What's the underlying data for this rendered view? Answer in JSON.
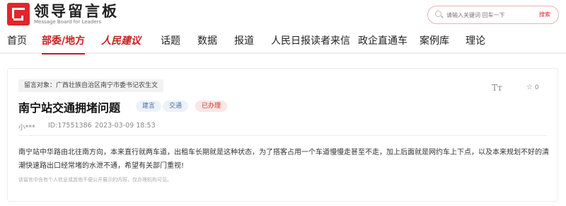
{
  "header": {
    "logo_cn": "领导留言板",
    "logo_en": "Message Board for Leaders",
    "search_placeholder": "请输入关键词 回车一下",
    "search_button": "搜索"
  },
  "nav": [
    "首页",
    "部委/地方",
    "人民建议",
    "话题",
    "数据",
    "报道",
    "人民日报读者来信",
    "政企直通车",
    "案例库",
    "理论"
  ],
  "message": {
    "target": "留言对象：广西壮族自治区南宁市委书记农生文",
    "title": "南宁站交通拥堵问题",
    "tags": [
      "建言",
      "交通",
      "已办理"
    ],
    "author": "小***",
    "id": "ID:17551386",
    "time": "2023-03-09 18:53",
    "font_icon": "Tт",
    "favorites": "0",
    "content": "南宁站中华路由北往南方向，本来直行就两车道，出租车长期就是这种状态，为了搭客占用一个车道慢慢走甚至不走，加上后面就是网约车上下点，以及本来规划不好的清潮快速路出口经常堵的水泄不通，希望有关部门重视!",
    "notice": "该留言中含有个人信息或其他不便公开展示的内容，仅办理机构可见。"
  },
  "colors": {
    "brand": "#e0262b",
    "accent": "#c81e1e"
  },
  "icons": [
    "logo-icon",
    "search-icon",
    "font-size-icon",
    "star-icon"
  ]
}
